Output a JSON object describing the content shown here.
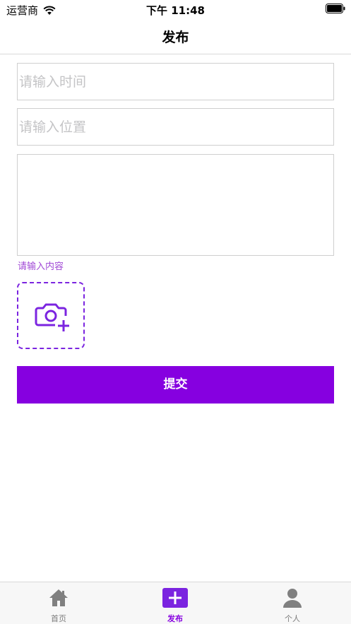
{
  "status_bar": {
    "carrier": "运营商",
    "time": "下午 11:48"
  },
  "nav": {
    "title": "发布"
  },
  "form": {
    "time_placeholder": "请输入时间",
    "location_placeholder": "请输入位置",
    "content_hint": "请输入内容",
    "submit_label": "提交"
  },
  "tab_bar": {
    "items": [
      {
        "label": "首页",
        "icon": "home-icon"
      },
      {
        "label": "发布",
        "icon": "plus-icon"
      },
      {
        "label": "个人",
        "icon": "person-icon"
      }
    ],
    "active_index": 1
  },
  "colors": {
    "accent": "#8600e0",
    "hint": "#a14ad6",
    "placeholder": "#c4c4c6",
    "inactive_tab": "#7c7c7c"
  }
}
